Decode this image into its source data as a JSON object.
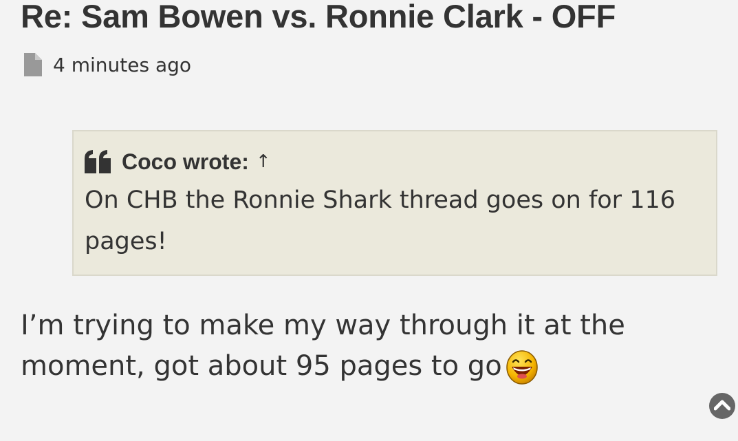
{
  "post": {
    "title": "Re: Sam Bowen vs. Ronnie Clark - OFF",
    "timestamp": "4 minutes ago",
    "meta_icon": "document-icon",
    "quote": {
      "icon": "quote-icon",
      "author": "Coco wrote:",
      "jump_arrow": "↑",
      "text": "On CHB the Ronnie Shark thread goes on for 116 pages!"
    },
    "body_text": "I’m trying to make my way through it at the moment, got about 95 pages to go",
    "smiley": "laughing-smiley"
  },
  "back_to_top": {
    "icon": "chevron-up-icon"
  },
  "colors": {
    "background": "#f3f3f3",
    "text": "#333333",
    "quote_background": "#ebe9dc",
    "quote_border": "#dad8cb"
  }
}
